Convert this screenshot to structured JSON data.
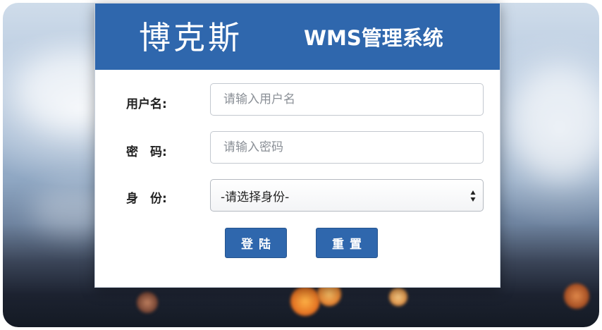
{
  "header": {
    "brand": "博克斯",
    "system_title": "WMS管理系统"
  },
  "form": {
    "username": {
      "label": "用户名:",
      "placeholder": "请输入用户名",
      "value": ""
    },
    "password": {
      "label": "密　码:",
      "placeholder": "请输入密码",
      "value": ""
    },
    "role": {
      "label": "身　份:",
      "selected": "-请选择身份-"
    }
  },
  "buttons": {
    "login": "登陆",
    "reset": "重置"
  },
  "colors": {
    "primary": "#2f67ad",
    "card_bg": "#ffffff"
  },
  "icons": {
    "select_arrows": "up-down-arrows-icon"
  }
}
